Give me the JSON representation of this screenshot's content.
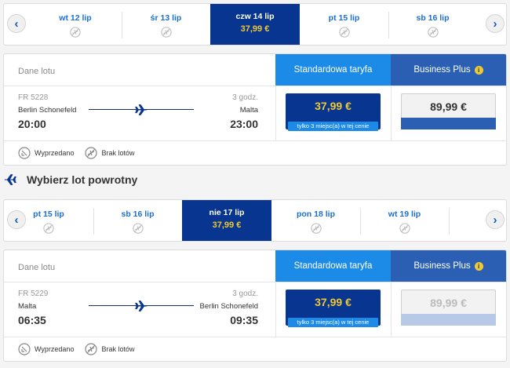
{
  "outbound_dates": {
    "days": [
      {
        "label": "wt 12 lip",
        "price": ""
      },
      {
        "label": "śr 13 lip",
        "price": ""
      },
      {
        "label": "czw 14 lip",
        "price": "37,99 €"
      },
      {
        "label": "pt 15 lip",
        "price": ""
      },
      {
        "label": "sb 16 lip",
        "price": ""
      }
    ]
  },
  "outbound_flight": {
    "header_label": "Dane lotu",
    "tab_standard": "Standardowa taryfa",
    "tab_business": "Business Plus",
    "flight_number": "FR 5228",
    "duration": "3 godz.",
    "origin": "Berlin Schonefeld",
    "destination": "Malta",
    "departure": "20:00",
    "arrival": "23:00",
    "standard_price": "37,99 €",
    "seats_note": "tylko 3 miejsc(a) w tej cenie",
    "business_price": "89,99 €"
  },
  "legend": {
    "sold_out": "Wyprzedano",
    "no_flights": "Brak lotów"
  },
  "return_section": {
    "title": "Wybierz lot powrotny"
  },
  "return_dates": {
    "days": [
      {
        "label": "pt 15 lip",
        "price": ""
      },
      {
        "label": "sb 16 lip",
        "price": ""
      },
      {
        "label": "nie 17 lip",
        "price": "37,99 €"
      },
      {
        "label": "pon 18 lip",
        "price": ""
      },
      {
        "label": "wt 19 lip",
        "price": ""
      }
    ]
  },
  "return_flight": {
    "header_label": "Dane lotu",
    "tab_standard": "Standardowa taryfa",
    "tab_business": "Business Plus",
    "flight_number": "FR 5229",
    "duration": "3 godz.",
    "origin": "Malta",
    "destination": "Berlin Schonefeld",
    "departure": "06:35",
    "arrival": "09:35",
    "standard_price": "37,99 €",
    "seats_note": "tylko 3 miejsc(a) w tej cenie",
    "business_price": "89,99 €"
  },
  "colors": {
    "navy": "#073590",
    "accent_blue": "#1c8be8",
    "business_blue": "#2b5fb3",
    "yellow": "#f1c931"
  },
  "icons": {
    "prev": "chevron-left-icon",
    "next": "chevron-right-icon",
    "no_flight": "no-flight-icon",
    "plane": "plane-icon",
    "info": "info-icon",
    "sold_out": "sold-out-icon"
  }
}
